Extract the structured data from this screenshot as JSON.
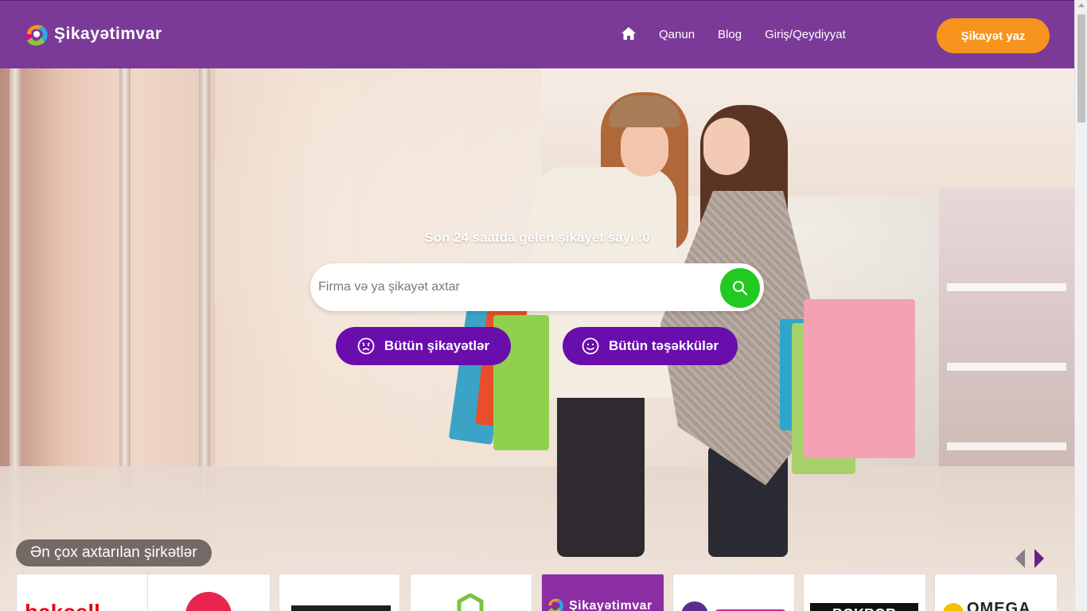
{
  "header": {
    "logo_text": "Şikayətimvar",
    "nav": [
      {
        "icon": "home-icon"
      },
      {
        "label": "Qanun"
      },
      {
        "label": "Blog"
      },
      {
        "label": "Giriş/Qeydiyyat"
      }
    ],
    "cta_label": "Şikayət yaz"
  },
  "hero": {
    "counter_text": "Son 24 saatda gelen şikayet sayı :0",
    "search_placeholder": "Firma və ya şikayət axtar",
    "search_icon": "search-icon",
    "buttons": [
      {
        "label": "Bütün şikayətlər",
        "icon": "sad-face-icon"
      },
      {
        "label": "Bütün təşəkkülər",
        "icon": "smile-face-icon"
      }
    ]
  },
  "companies": {
    "title": "Ən çox axtarılan şirkətlər",
    "logos": [
      {
        "name": "bakcell",
        "text": "bakcell"
      },
      {
        "name": "red-circle-logo",
        "text": ""
      },
      {
        "name": "dark-banner-logo",
        "text": ""
      },
      {
        "name": "green-hexagon-logo",
        "text": ""
      },
      {
        "name": "sikayetimvar",
        "text": "Şikayətimvar"
      },
      {
        "name": "azercell-logo",
        "text": ""
      },
      {
        "name": "bokbor-logo",
        "text": "BOKBOR"
      },
      {
        "name": "omega",
        "text": "OMEGA"
      }
    ]
  },
  "colors": {
    "header_bg": "#7b3a98",
    "cta_bg": "#f7941d",
    "pill_bg": "#6a0dad",
    "search_button_bg": "#22c922"
  }
}
